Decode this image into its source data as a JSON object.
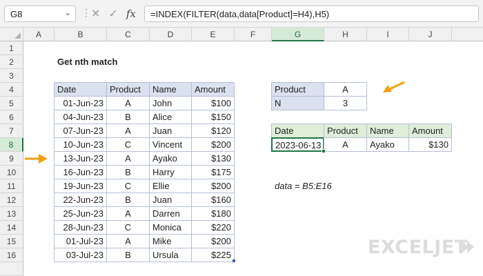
{
  "formula_bar": {
    "name_box": "G8",
    "formula": "=INDEX(FILTER(data,data[Product]=H4),H5)",
    "icons": [
      "cancel-icon",
      "confirm-icon",
      "function-icon"
    ]
  },
  "columns": [
    "A",
    "B",
    "C",
    "D",
    "E",
    "F",
    "G",
    "H",
    "I",
    "J"
  ],
  "active_column": "G",
  "rows": [
    "1",
    "2",
    "3",
    "4",
    "5",
    "6",
    "7",
    "8",
    "9",
    "10",
    "11",
    "12",
    "13",
    "14",
    "15",
    "16"
  ],
  "active_row": "8",
  "title": "Get nth match",
  "data_table": {
    "headers": [
      "Date",
      "Product",
      "Name",
      "Amount"
    ],
    "rows": [
      [
        "01-Jun-23",
        "A",
        "John",
        "$100"
      ],
      [
        "04-Jun-23",
        "B",
        "Alice",
        "$150"
      ],
      [
        "07-Jun-23",
        "A",
        "Juan",
        "$120"
      ],
      [
        "10-Jun-23",
        "C",
        "Vincent",
        "$200"
      ],
      [
        "13-Jun-23",
        "A",
        "Ayako",
        "$130"
      ],
      [
        "16-Jun-23",
        "B",
        "Harry",
        "$175"
      ],
      [
        "19-Jun-23",
        "C",
        "Ellie",
        "$200"
      ],
      [
        "22-Jun-23",
        "B",
        "Juan",
        "$160"
      ],
      [
        "25-Jun-23",
        "A",
        "Darren",
        "$180"
      ],
      [
        "28-Jun-23",
        "C",
        "Monica",
        "$220"
      ],
      [
        "01-Jul-23",
        "A",
        "Mike",
        "$200"
      ],
      [
        "03-Jul-23",
        "B",
        "Ursula",
        "$225"
      ]
    ]
  },
  "inputs": {
    "product_label": "Product",
    "product_value": "A",
    "n_label": "N",
    "n_value": "3"
  },
  "result_table": {
    "headers": [
      "Date",
      "Product",
      "Name",
      "Amount"
    ],
    "row": [
      "2023-06-13",
      "A",
      "Ayako",
      "$130"
    ]
  },
  "note": "data = B5:E16",
  "brand": "EXCELJET",
  "colors": {
    "accent_green": "#217346",
    "arrow_orange": "#f2a20c",
    "table_header_blue": "#dbe1ee",
    "table_header_green": "#dfeed8"
  }
}
